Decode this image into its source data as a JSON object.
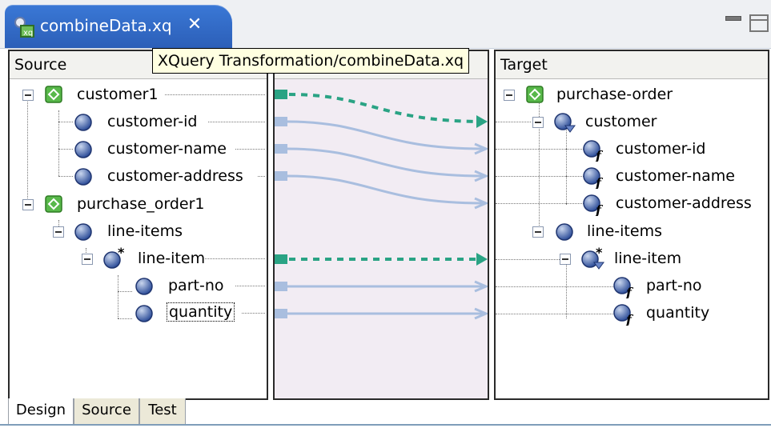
{
  "editor": {
    "tab_title": "combineData.xq",
    "tooltip": "XQuery Transformation/combineData.xq"
  },
  "panes": {
    "source_header": "Source",
    "target_header": "Target"
  },
  "source_tree": [
    {
      "label": "customer1",
      "icon": "element-icon"
    },
    {
      "label": "customer-id",
      "icon": "attribute-icon"
    },
    {
      "label": "customer-name",
      "icon": "attribute-icon"
    },
    {
      "label": "customer-address",
      "icon": "attribute-icon"
    },
    {
      "label": "purchase_order1",
      "icon": "element-icon"
    },
    {
      "label": "line-items",
      "icon": "attribute-icon"
    },
    {
      "label": "line-item",
      "icon": "repeating-element-icon"
    },
    {
      "label": "part-no",
      "icon": "attribute-icon"
    },
    {
      "label": "quantity",
      "icon": "attribute-icon"
    }
  ],
  "target_tree": [
    {
      "label": "purchase-order",
      "icon": "element-icon"
    },
    {
      "label": "customer",
      "icon": "filtered-element-icon"
    },
    {
      "label": "customer-id",
      "icon": "function-node-icon"
    },
    {
      "label": "customer-name",
      "icon": "function-node-icon"
    },
    {
      "label": "customer-address",
      "icon": "function-node-icon"
    },
    {
      "label": "line-items",
      "icon": "attribute-icon"
    },
    {
      "label": "line-item",
      "icon": "repeating-filtered-element-icon"
    },
    {
      "label": "part-no",
      "icon": "function-node-icon"
    },
    {
      "label": "quantity",
      "icon": "function-node-icon"
    }
  ],
  "bottom_tabs": [
    "Design",
    "Source",
    "Test"
  ],
  "colors": {
    "tab_blue": "#2f67c6",
    "mapping_bg": "#f2ecf3",
    "structure_link": "#2aa384",
    "value_link": "#a9bedf"
  }
}
